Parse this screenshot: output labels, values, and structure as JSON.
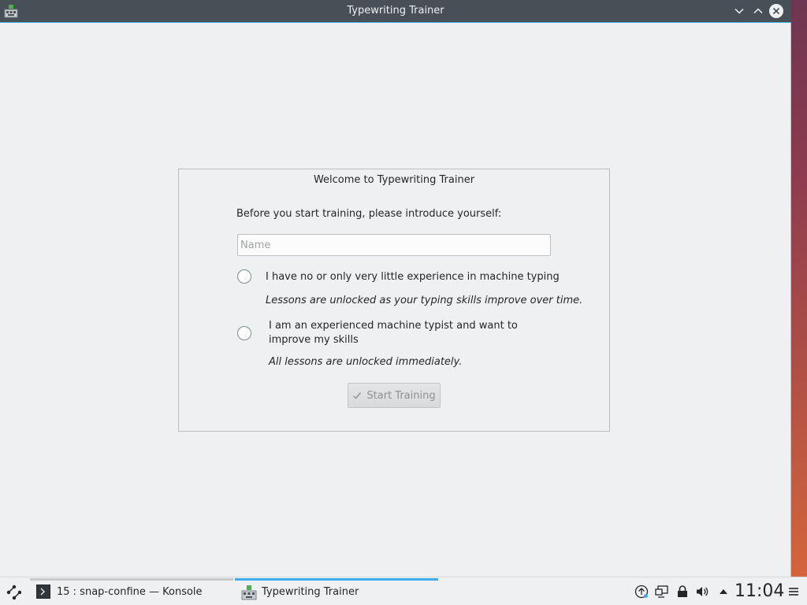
{
  "window": {
    "title": "Typewriting Trainer"
  },
  "welcome": {
    "title": "Welcome to Typewriting Trainer",
    "intro": "Before you start training, please introduce yourself:",
    "name_placeholder": "Name",
    "name_value": "",
    "option_beginner": {
      "label": "I have no or only very little experience in machine typing",
      "hint": "Lessons are unlocked as your typing skills improve over time.",
      "selected": false
    },
    "option_experienced": {
      "label": "I am an experienced machine typist and want to improve my skills",
      "hint": "All lessons are unlocked immediately.",
      "selected": false
    },
    "start_button": {
      "label": "Start Training",
      "enabled": false
    }
  },
  "taskbar": {
    "tasks": [
      {
        "label": "15 : snap-confine — Konsole",
        "icon": "konsole-icon",
        "active": false
      },
      {
        "label": "Typewriting Trainer",
        "icon": "ktouch-icon",
        "active": true
      }
    ],
    "tray_icons": [
      "updates-icon",
      "display-icon",
      "lock-icon",
      "volume-icon",
      "tray-expand-icon"
    ],
    "clock": "11:04"
  },
  "colors": {
    "accent": "#3daee9",
    "titlebar": "#475057",
    "window_bg": "#eff0f1"
  }
}
